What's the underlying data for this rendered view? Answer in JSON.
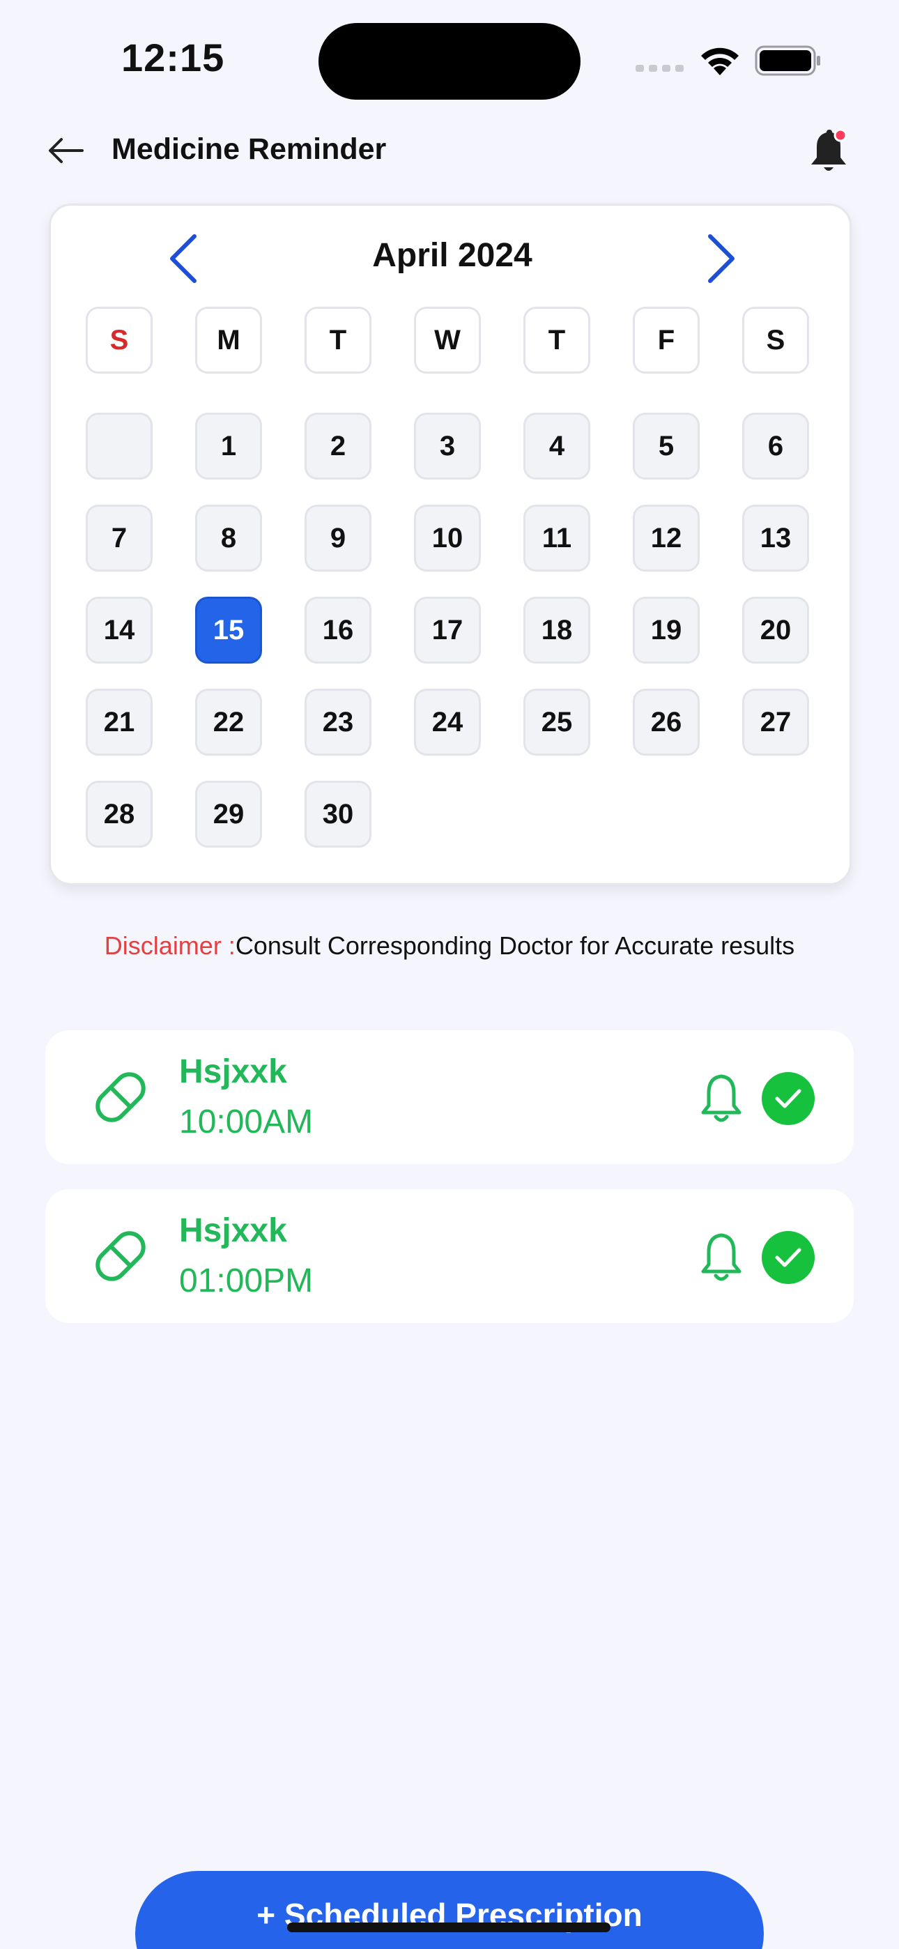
{
  "status_bar": {
    "time": "12:15"
  },
  "header": {
    "title": "Medicine Reminder"
  },
  "calendar": {
    "month_label": "April 2024",
    "weekdays": [
      "S",
      "M",
      "T",
      "W",
      "T",
      "F",
      "S"
    ],
    "selected_day": "15",
    "days": [
      "1",
      "2",
      "3",
      "4",
      "5",
      "6",
      "7",
      "8",
      "9",
      "10",
      "11",
      "12",
      "13",
      "14",
      "15",
      "16",
      "17",
      "18",
      "19",
      "20",
      "21",
      "22",
      "23",
      "24",
      "25",
      "26",
      "27",
      "28",
      "29",
      "30"
    ]
  },
  "disclaimer": {
    "label": "Disclaimer :",
    "text": "Consult Corresponding Doctor for Accurate results"
  },
  "reminders": [
    {
      "name": "Hsjxxk",
      "time": "10:00AM"
    },
    {
      "name": "Hsjxxk",
      "time": "01:00PM"
    }
  ],
  "cta": {
    "label": "+ Scheduled Prescription"
  },
  "colors": {
    "accent": "#2563eb",
    "green": "#22b85a",
    "check": "#16c13d",
    "sunday": "#d82a2a",
    "disclaimer": "#e34040"
  },
  "icons": [
    "back-arrow-icon",
    "bell-icon",
    "chevron-left-icon",
    "chevron-right-icon",
    "pill-icon",
    "bell-outline-icon",
    "check-icon",
    "wifi-icon",
    "battery-icon",
    "signal-icon"
  ]
}
